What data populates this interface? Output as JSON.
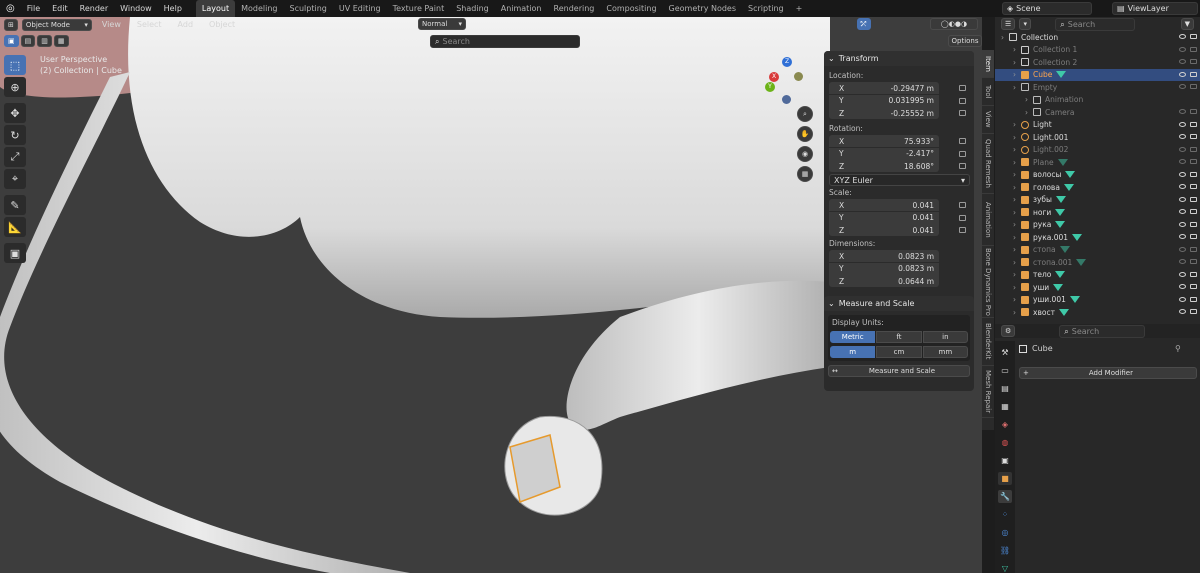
{
  "topbar": {
    "menus": [
      "File",
      "Edit",
      "Render",
      "Window",
      "Help"
    ],
    "workspaces": [
      "Layout",
      "Modeling",
      "Sculpting",
      "UV Editing",
      "Texture Paint",
      "Shading",
      "Animation",
      "Rendering",
      "Compositing",
      "Geometry Nodes",
      "Scripting"
    ],
    "active_workspace": "Layout",
    "add_tab": "+",
    "scene": "Scene",
    "view_layer": "ViewLayer"
  },
  "viewport": {
    "mode": "Object Mode",
    "menus": [
      "View",
      "Select",
      "Add",
      "Object"
    ],
    "orientation": "Normal",
    "search_placeholder": "Search",
    "options": "Options",
    "info_line1": "User Perspective",
    "info_line2": "(2) Collection | Cube",
    "gizmo": {
      "x": "X",
      "y": "Y",
      "z": "Z"
    }
  },
  "transform": {
    "title": "Transform",
    "location_label": "Location:",
    "location": [
      {
        "axis": "X",
        "value": "-0.29477 m"
      },
      {
        "axis": "Y",
        "value": "0.031995 m"
      },
      {
        "axis": "Z",
        "value": "-0.25552 m"
      }
    ],
    "rotation_label": "Rotation:",
    "rotation": [
      {
        "axis": "X",
        "value": "75.933°"
      },
      {
        "axis": "Y",
        "value": "-2.417°"
      },
      {
        "axis": "Z",
        "value": "18.608°"
      }
    ],
    "rotation_mode": "XYZ Euler",
    "scale_label": "Scale:",
    "scale": [
      {
        "axis": "X",
        "value": "0.041"
      },
      {
        "axis": "Y",
        "value": "0.041"
      },
      {
        "axis": "Z",
        "value": "0.041"
      }
    ],
    "dimensions_label": "Dimensions:",
    "dimensions": [
      {
        "axis": "X",
        "value": "0.0823 m"
      },
      {
        "axis": "Y",
        "value": "0.0823 m"
      },
      {
        "axis": "Z",
        "value": "0.0644 m"
      }
    ]
  },
  "measure": {
    "title": "Measure and Scale",
    "display_units": "Display Units:",
    "systems": [
      "Metric",
      "ft",
      "in"
    ],
    "units": [
      "m",
      "cm",
      "mm"
    ],
    "button": "Measure and Scale"
  },
  "side_tabs": [
    "Item",
    "Tool",
    "View",
    "Quad Remesh",
    "Animation",
    "Bone Dynamics Pro",
    "BlenderKit",
    "Mesh Repair"
  ],
  "outliner": {
    "search_placeholder": "Search",
    "rows": [
      {
        "name": "Collection",
        "indent": 0,
        "type": "coll",
        "dim": false,
        "sel": false
      },
      {
        "name": "Collection 1",
        "indent": 1,
        "type": "coll",
        "dim": true,
        "sel": false
      },
      {
        "name": "Collection 2",
        "indent": 1,
        "type": "coll",
        "dim": true,
        "sel": false
      },
      {
        "name": "Cube",
        "indent": 1,
        "type": "mesh",
        "dim": false,
        "sel": true
      },
      {
        "name": "Empty",
        "indent": 1,
        "type": "empty",
        "dim": true,
        "sel": false
      },
      {
        "name": "Animation",
        "indent": 2,
        "type": "empty",
        "dim": true,
        "sel": false
      },
      {
        "name": "Camera",
        "indent": 2,
        "type": "cam",
        "dim": true,
        "sel": false
      },
      {
        "name": "Light",
        "indent": 1,
        "type": "light",
        "dim": false,
        "sel": false
      },
      {
        "name": "Light.001",
        "indent": 1,
        "type": "light",
        "dim": false,
        "sel": false
      },
      {
        "name": "Light.002",
        "indent": 1,
        "type": "light",
        "dim": true,
        "sel": false
      },
      {
        "name": "Plane",
        "indent": 1,
        "type": "mesh",
        "dim": true,
        "sel": false
      },
      {
        "name": "волосы",
        "indent": 1,
        "type": "mesh",
        "dim": false,
        "sel": false
      },
      {
        "name": "голова",
        "indent": 1,
        "type": "mesh",
        "dim": false,
        "sel": false
      },
      {
        "name": "зубы",
        "indent": 1,
        "type": "mesh",
        "dim": false,
        "sel": false
      },
      {
        "name": "ноги",
        "indent": 1,
        "type": "mesh",
        "dim": false,
        "sel": false
      },
      {
        "name": "рука",
        "indent": 1,
        "type": "mesh",
        "dim": false,
        "sel": false
      },
      {
        "name": "рука.001",
        "indent": 1,
        "type": "mesh",
        "dim": false,
        "sel": false
      },
      {
        "name": "стопа",
        "indent": 1,
        "type": "mesh",
        "dim": true,
        "sel": false
      },
      {
        "name": "стопа.001",
        "indent": 1,
        "type": "mesh",
        "dim": true,
        "sel": false
      },
      {
        "name": "тело",
        "indent": 1,
        "type": "mesh",
        "dim": false,
        "sel": false
      },
      {
        "name": "уши",
        "indent": 1,
        "type": "mesh",
        "dim": false,
        "sel": false
      },
      {
        "name": "уши.001",
        "indent": 1,
        "type": "mesh",
        "dim": false,
        "sel": false
      },
      {
        "name": "хвост",
        "indent": 1,
        "type": "mesh",
        "dim": false,
        "sel": false
      }
    ]
  },
  "properties": {
    "search_placeholder": "Search",
    "object_name": "Cube",
    "add_modifier": "Add Modifier"
  },
  "colors": {
    "accent": "#4772b3",
    "selected_row": "#334d80",
    "mesh_icon": "#3fc9a8",
    "light_icon": "#e6a04a"
  }
}
